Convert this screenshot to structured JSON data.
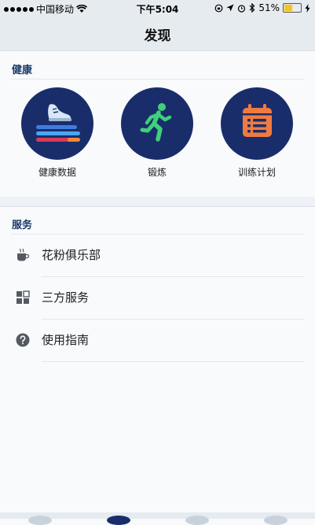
{
  "status_bar": {
    "carrier": "中国移动",
    "time": "下午5:04",
    "battery_percent": "51%",
    "battery_level": 0.51
  },
  "nav": {
    "title": "发现"
  },
  "health": {
    "title": "健康",
    "items": [
      {
        "label": "健康数据",
        "icon": "shoe-icon"
      },
      {
        "label": "锻炼",
        "icon": "runner-icon"
      },
      {
        "label": "训练计划",
        "icon": "calendar-icon"
      }
    ]
  },
  "services": {
    "title": "服务",
    "items": [
      {
        "label": "花粉俱乐部",
        "icon": "coffee-cup-icon"
      },
      {
        "label": "三方服务",
        "icon": "grid-icon"
      },
      {
        "label": "使用指南",
        "icon": "help-icon"
      }
    ]
  },
  "colors": {
    "accent": "#1a2d6b",
    "section_title": "#1b3a6b",
    "runner": "#3fd07b",
    "calendar": "#f07b3f"
  }
}
